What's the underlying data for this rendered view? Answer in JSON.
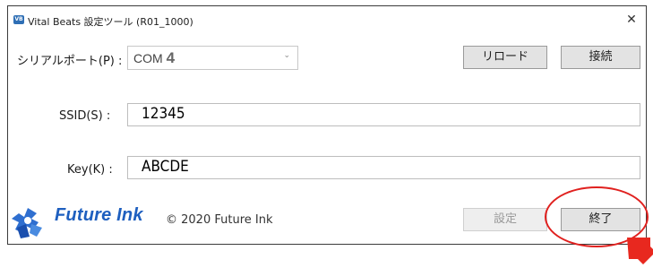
{
  "window": {
    "title": "Vital Beats 設定ツール (R01_1000)",
    "app_icon_label": "VB",
    "close_label": "✕"
  },
  "serial": {
    "label": "シリアルポート(P) :",
    "port_prefix": "COM",
    "port_number": "4",
    "dropdown_arrow": "⌄"
  },
  "buttons": {
    "reload": "リロード",
    "connect": "接続",
    "settings": "設定",
    "exit": "終了"
  },
  "ssid": {
    "label": "SSID(S) :",
    "value": "12345"
  },
  "key": {
    "label": "Key(K) :",
    "value": "ABCDE"
  },
  "footer": {
    "brand": "Future Ink",
    "copyright": "© 2020 Future Ink"
  },
  "colors": {
    "brand": "#1e5fbf",
    "highlight": "#e0211f"
  }
}
